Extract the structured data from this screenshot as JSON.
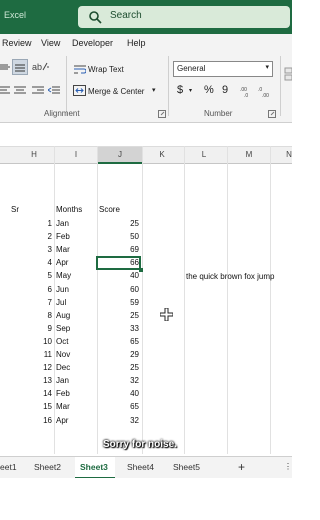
{
  "title_bar": {
    "app_name": "Excel",
    "search_label": "Search"
  },
  "menu": [
    "Review",
    "View",
    "Developer",
    "Help"
  ],
  "ribbon": {
    "wrap_text": "Wrap Text",
    "merge_center": "Merge & Center",
    "alignment_group": "Alignment",
    "number_format": "General",
    "currency": "$",
    "percent": "%",
    "comma": "9",
    "number_group": "Number"
  },
  "columns": [
    "H",
    "I",
    "J",
    "K",
    "L",
    "M"
  ],
  "table": {
    "sr_header": "Sr",
    "months_header": "Months",
    "score_header": "Score",
    "rows": [
      {
        "sr": "1",
        "month": "Jan",
        "score": "25"
      },
      {
        "sr": "2",
        "month": "Feb",
        "score": "50"
      },
      {
        "sr": "3",
        "month": "Mar",
        "score": "69"
      },
      {
        "sr": "4",
        "month": "Apr",
        "score": "66"
      },
      {
        "sr": "5",
        "month": "May",
        "score": "40"
      },
      {
        "sr": "6",
        "month": "Jun",
        "score": "60"
      },
      {
        "sr": "7",
        "month": "Jul",
        "score": "59"
      },
      {
        "sr": "8",
        "month": "Aug",
        "score": "25"
      },
      {
        "sr": "9",
        "month": "Sep",
        "score": "33"
      },
      {
        "sr": "10",
        "month": "Oct",
        "score": "65"
      },
      {
        "sr": "11",
        "month": "Nov",
        "score": "29"
      },
      {
        "sr": "12",
        "month": "Dec",
        "score": "25"
      },
      {
        "sr": "13",
        "month": "Jan",
        "score": "32"
      },
      {
        "sr": "14",
        "month": "Feb",
        "score": "40"
      },
      {
        "sr": "15",
        "month": "Mar",
        "score": "65"
      },
      {
        "sr": "16",
        "month": "Apr",
        "score": "32"
      }
    ]
  },
  "side_text": "the quick brown fox jump",
  "caption": "Sorry for noise.",
  "sheets": [
    "eet1",
    "Sheet2",
    "Sheet3",
    "Sheet4",
    "Sheet5"
  ],
  "active_sheet": "Sheet3",
  "add_sheet": "+"
}
